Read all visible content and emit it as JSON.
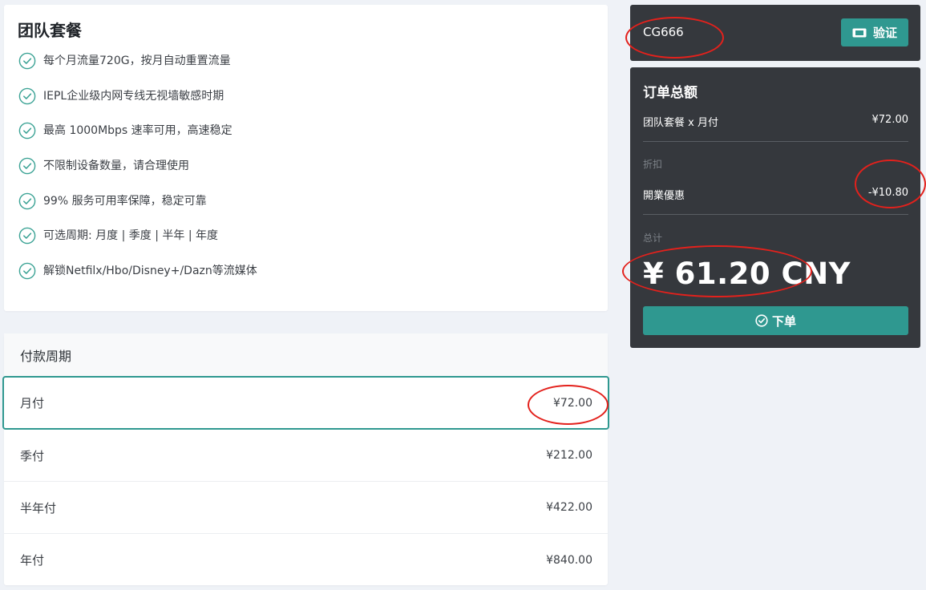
{
  "plan": {
    "title": "团队套餐",
    "features": [
      "每个月流量720G，按月自动重置流量",
      "IEPL企业级内网专线无视墙敏感时期",
      "最高 1000Mbps 速率可用，高速稳定",
      "不限制设备数量，请合理使用",
      "99% 服务可用率保障，稳定可靠",
      "可选周期: 月度 | 季度 | 半年 | 年度",
      "解锁Netfilx/Hbo/Disney+/Dazn等流媒体"
    ],
    "feature_icon": "check-circle-icon"
  },
  "billing": {
    "header": "付款周期",
    "options": [
      {
        "label": "月付",
        "price": "¥72.00",
        "selected": true
      },
      {
        "label": "季付",
        "price": "¥212.00",
        "selected": false
      },
      {
        "label": "半年付",
        "price": "¥422.00",
        "selected": false
      },
      {
        "label": "年付",
        "price": "¥840.00",
        "selected": false
      }
    ]
  },
  "coupon": {
    "code": "CG666",
    "verify_label": "验证",
    "verify_icon": "ticket-icon"
  },
  "summary": {
    "title": "订单总额",
    "item_label": "团队套餐 x 月付",
    "item_price": "¥72.00",
    "discount_section": "折扣",
    "discount_label": "開業優惠",
    "discount_value": "-¥10.80",
    "total_section": "总计",
    "total": "¥ 61.20 CNY",
    "order_label": "下单",
    "order_icon": "check-circle-icon"
  },
  "colors": {
    "accent": "#2f9890",
    "dark_panel": "#35383d",
    "background": "#eff2f7",
    "annotation": "#e3211c"
  }
}
